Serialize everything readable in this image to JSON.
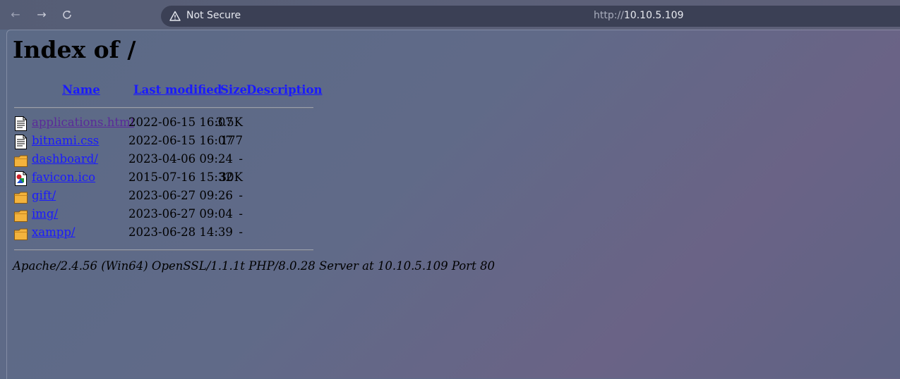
{
  "browser": {
    "security_label": "Not Secure",
    "url_scheme": "http://",
    "url_host": "10.10.5.109"
  },
  "page": {
    "title": "Index of /",
    "columns": {
      "name": "Name",
      "last_modified": "Last modified",
      "size": "Size",
      "description": "Description"
    },
    "entries": [
      {
        "name": "applications.html",
        "modified": "2022-06-15 16:07",
        "size": "3.5K",
        "icon": "text-file-icon",
        "visited": true
      },
      {
        "name": "bitnami.css",
        "modified": "2022-06-15 16:07",
        "size": "177",
        "icon": "text-file-icon",
        "visited": false
      },
      {
        "name": "dashboard/",
        "modified": "2023-04-06 09:24",
        "size": "-",
        "icon": "folder-icon",
        "visited": false
      },
      {
        "name": "favicon.ico",
        "modified": "2015-07-16 15:32",
        "size": "30K",
        "icon": "image-file-icon",
        "visited": false
      },
      {
        "name": "gift/",
        "modified": "2023-06-27 09:26",
        "size": "-",
        "icon": "folder-icon",
        "visited": false
      },
      {
        "name": "img/",
        "modified": "2023-06-27 09:04",
        "size": "-",
        "icon": "folder-icon",
        "visited": false
      },
      {
        "name": "xampp/",
        "modified": "2023-06-28 14:39",
        "size": "-",
        "icon": "folder-icon",
        "visited": false
      }
    ],
    "server_signature": "Apache/2.4.56 (Win64) OpenSSL/1.1.1t PHP/8.0.28 Server at 10.10.5.109 Port 80"
  },
  "colors": {
    "link": "#1a1aff",
    "visited_link": "#5a2a9a"
  }
}
